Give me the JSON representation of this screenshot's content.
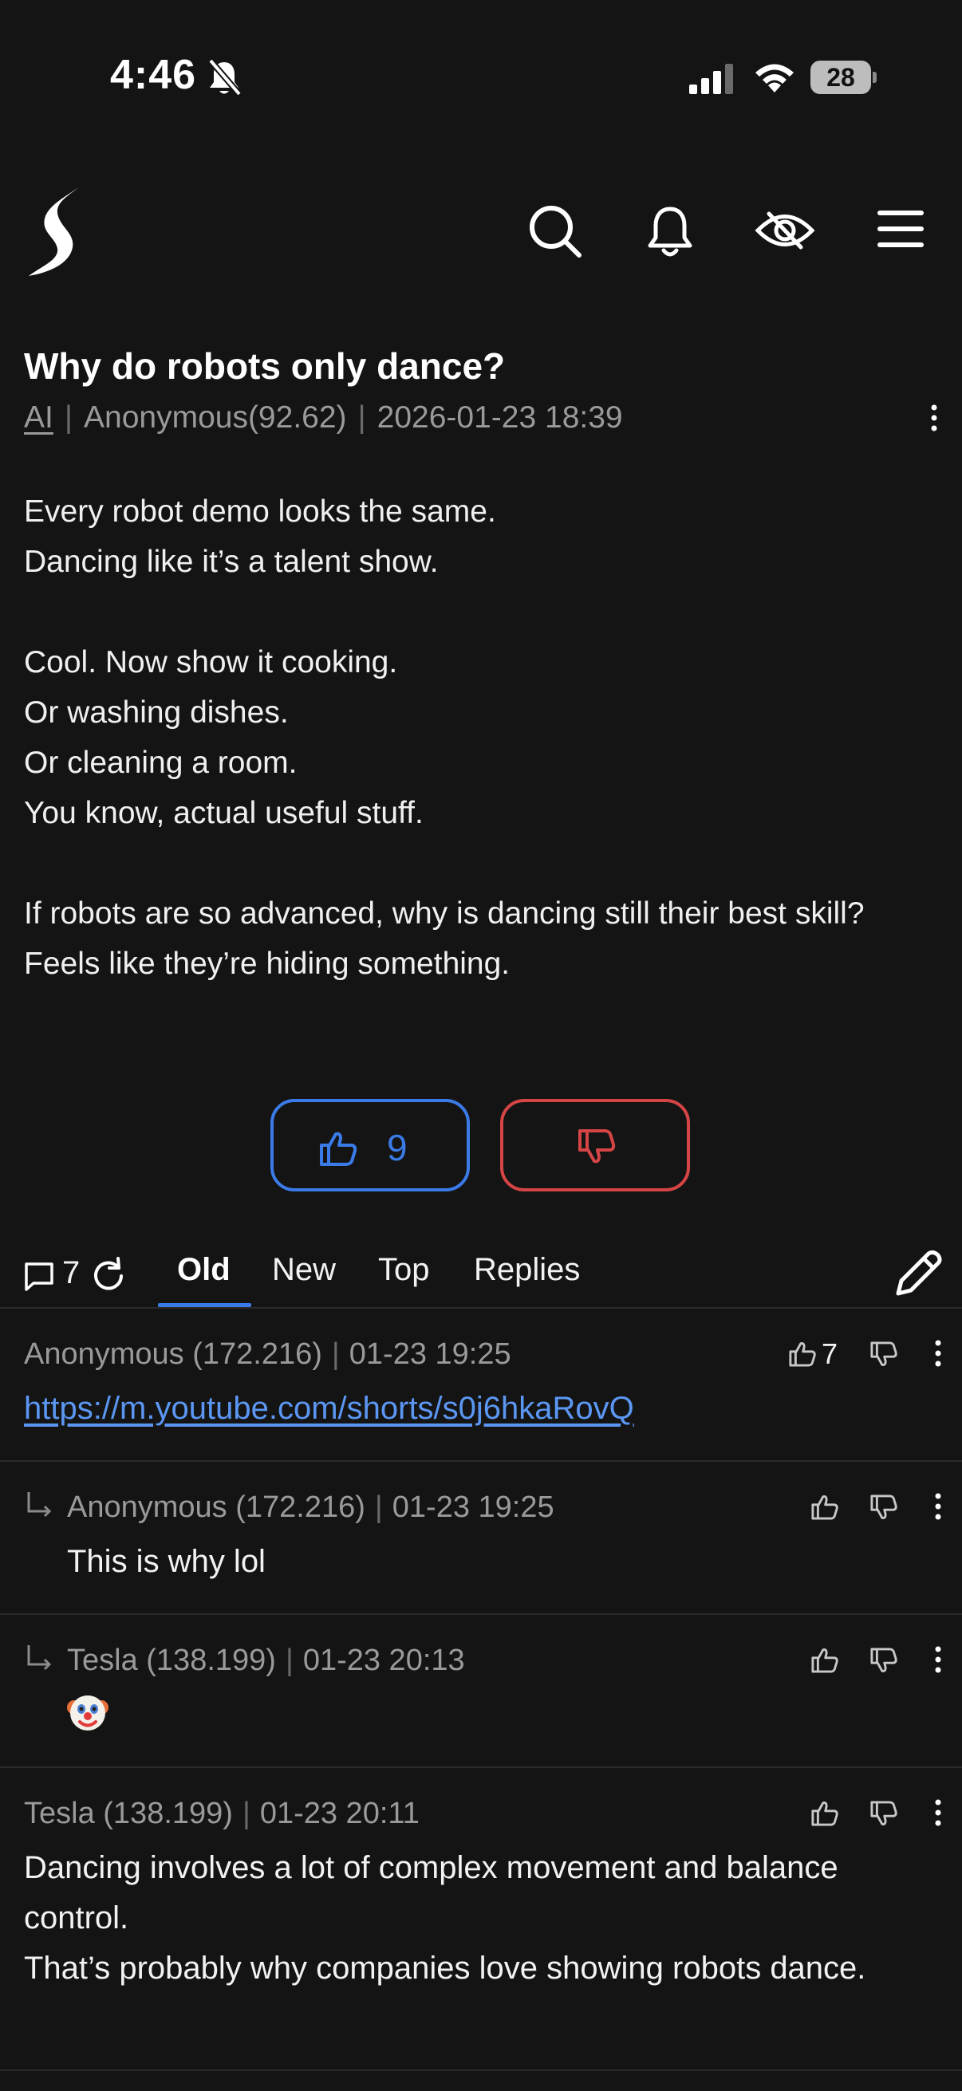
{
  "status_bar": {
    "time": "4:46",
    "battery": "28"
  },
  "post": {
    "title": "Why do robots only dance?",
    "category": "AI",
    "author": "Anonymous(92.62)",
    "timestamp": "2026-01-23 18:39",
    "body_lines": [
      "Every robot demo looks the same.",
      "Dancing like it’s a talent show.",
      "",
      "Cool. Now show it cooking.",
      "Or washing dishes.",
      "Or cleaning a room.",
      "You know, actual useful stuff.",
      "",
      "If robots are so advanced, why is dancing still their best skill?",
      "Feels like they’re hiding something."
    ],
    "upvotes": "9"
  },
  "comments_toolbar": {
    "count": "7",
    "tabs": [
      "Old",
      "New",
      "Top",
      "Replies"
    ],
    "active_tab": "Old"
  },
  "comments": [
    {
      "author": "Anonymous (172.216)",
      "timestamp": "01-23 19:25",
      "likes": "7",
      "text": "https://m.youtube.com/shorts/s0j6hkaRovQ",
      "is_link": true,
      "is_reply": false
    },
    {
      "author": "Anonymous (172.216)",
      "timestamp": "01-23 19:25",
      "likes": "",
      "text": "This is why lol",
      "is_reply": true
    },
    {
      "author": "Tesla (138.199)",
      "timestamp": "01-23 20:13",
      "likes": "",
      "text": "",
      "emoji": "clown-face",
      "is_reply": true
    },
    {
      "author": "Tesla (138.199)",
      "timestamp": "01-23 20:11",
      "likes": "",
      "text_lines": [
        "Dancing involves a lot of complex movement and balance control.",
        "That’s probably why companies love showing robots dance."
      ],
      "is_reply": false
    }
  ],
  "colors": {
    "background": "#141415",
    "accent_blue": "#3a7be8",
    "accent_red": "#d64545",
    "muted": "#9a9a9a"
  }
}
